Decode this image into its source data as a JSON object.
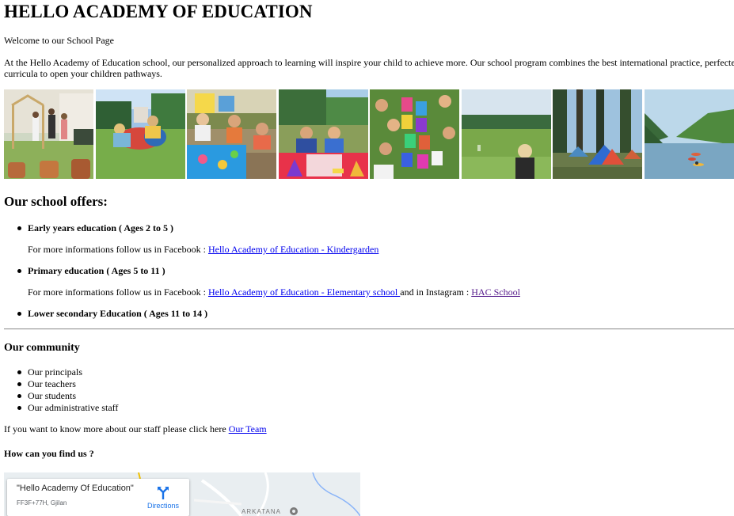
{
  "page": {
    "title": "HELLO ACADEMY OF EDUCATION",
    "welcome": "Welcome to our School Page",
    "intro_line1": "At the Hello Academy of Education school, our personalized approach to learning will inspire your child to achieve more. Our school program combines the best international practice, perfecte",
    "intro_line2": "curricula to open your children pathways."
  },
  "gallery": {
    "photos": [
      {
        "subject": "children playing by wooden frame in garden"
      },
      {
        "subject": "children crawling through play tunnel on grass"
      },
      {
        "subject": "children at outdoor water play table"
      },
      {
        "subject": "children with colorful water trays"
      },
      {
        "subject": "children painting colorful papers"
      },
      {
        "subject": "girl in green mountain meadow"
      },
      {
        "subject": "tents camping in forest"
      },
      {
        "subject": "kayaks on mountain lake"
      }
    ]
  },
  "offers": {
    "heading": "Our school offers:",
    "items": [
      {
        "label": "Early years education ( Ages 2 to 5 )",
        "info_prefix": "For more informations follow us in Facebook : ",
        "link_text": "Hello Academy of Education - Kindergarden"
      },
      {
        "label": "Primary education ( Ages 5 to 11 )",
        "info_prefix": "For more informations follow us in Facebook : ",
        "link_text": "Hello Academy of Education - Elementary school ",
        "info_middle": "and in Instagram : ",
        "link2_text": "HAC School"
      },
      {
        "label": "Lower secondary Education ( Ages 11 to 14 )"
      }
    ]
  },
  "community": {
    "heading": "Our community",
    "items": [
      "Our principals",
      "Our teachers",
      "Our students",
      "Our administrative staff"
    ],
    "staff_prefix": "If you want to know more about our staff please click here ",
    "staff_link": "Our Team"
  },
  "location": {
    "heading": "How can you find us ?",
    "map": {
      "place_name": "\"Hello Academy Of Education\"",
      "address": "FF3F+77H, Gjilan",
      "directions_label": "Directions",
      "area_label": "ARKATANA"
    }
  },
  "colors": {
    "link": "#0000ee",
    "visited_link": "#551a8b",
    "map_accent": "#1a73e8"
  }
}
